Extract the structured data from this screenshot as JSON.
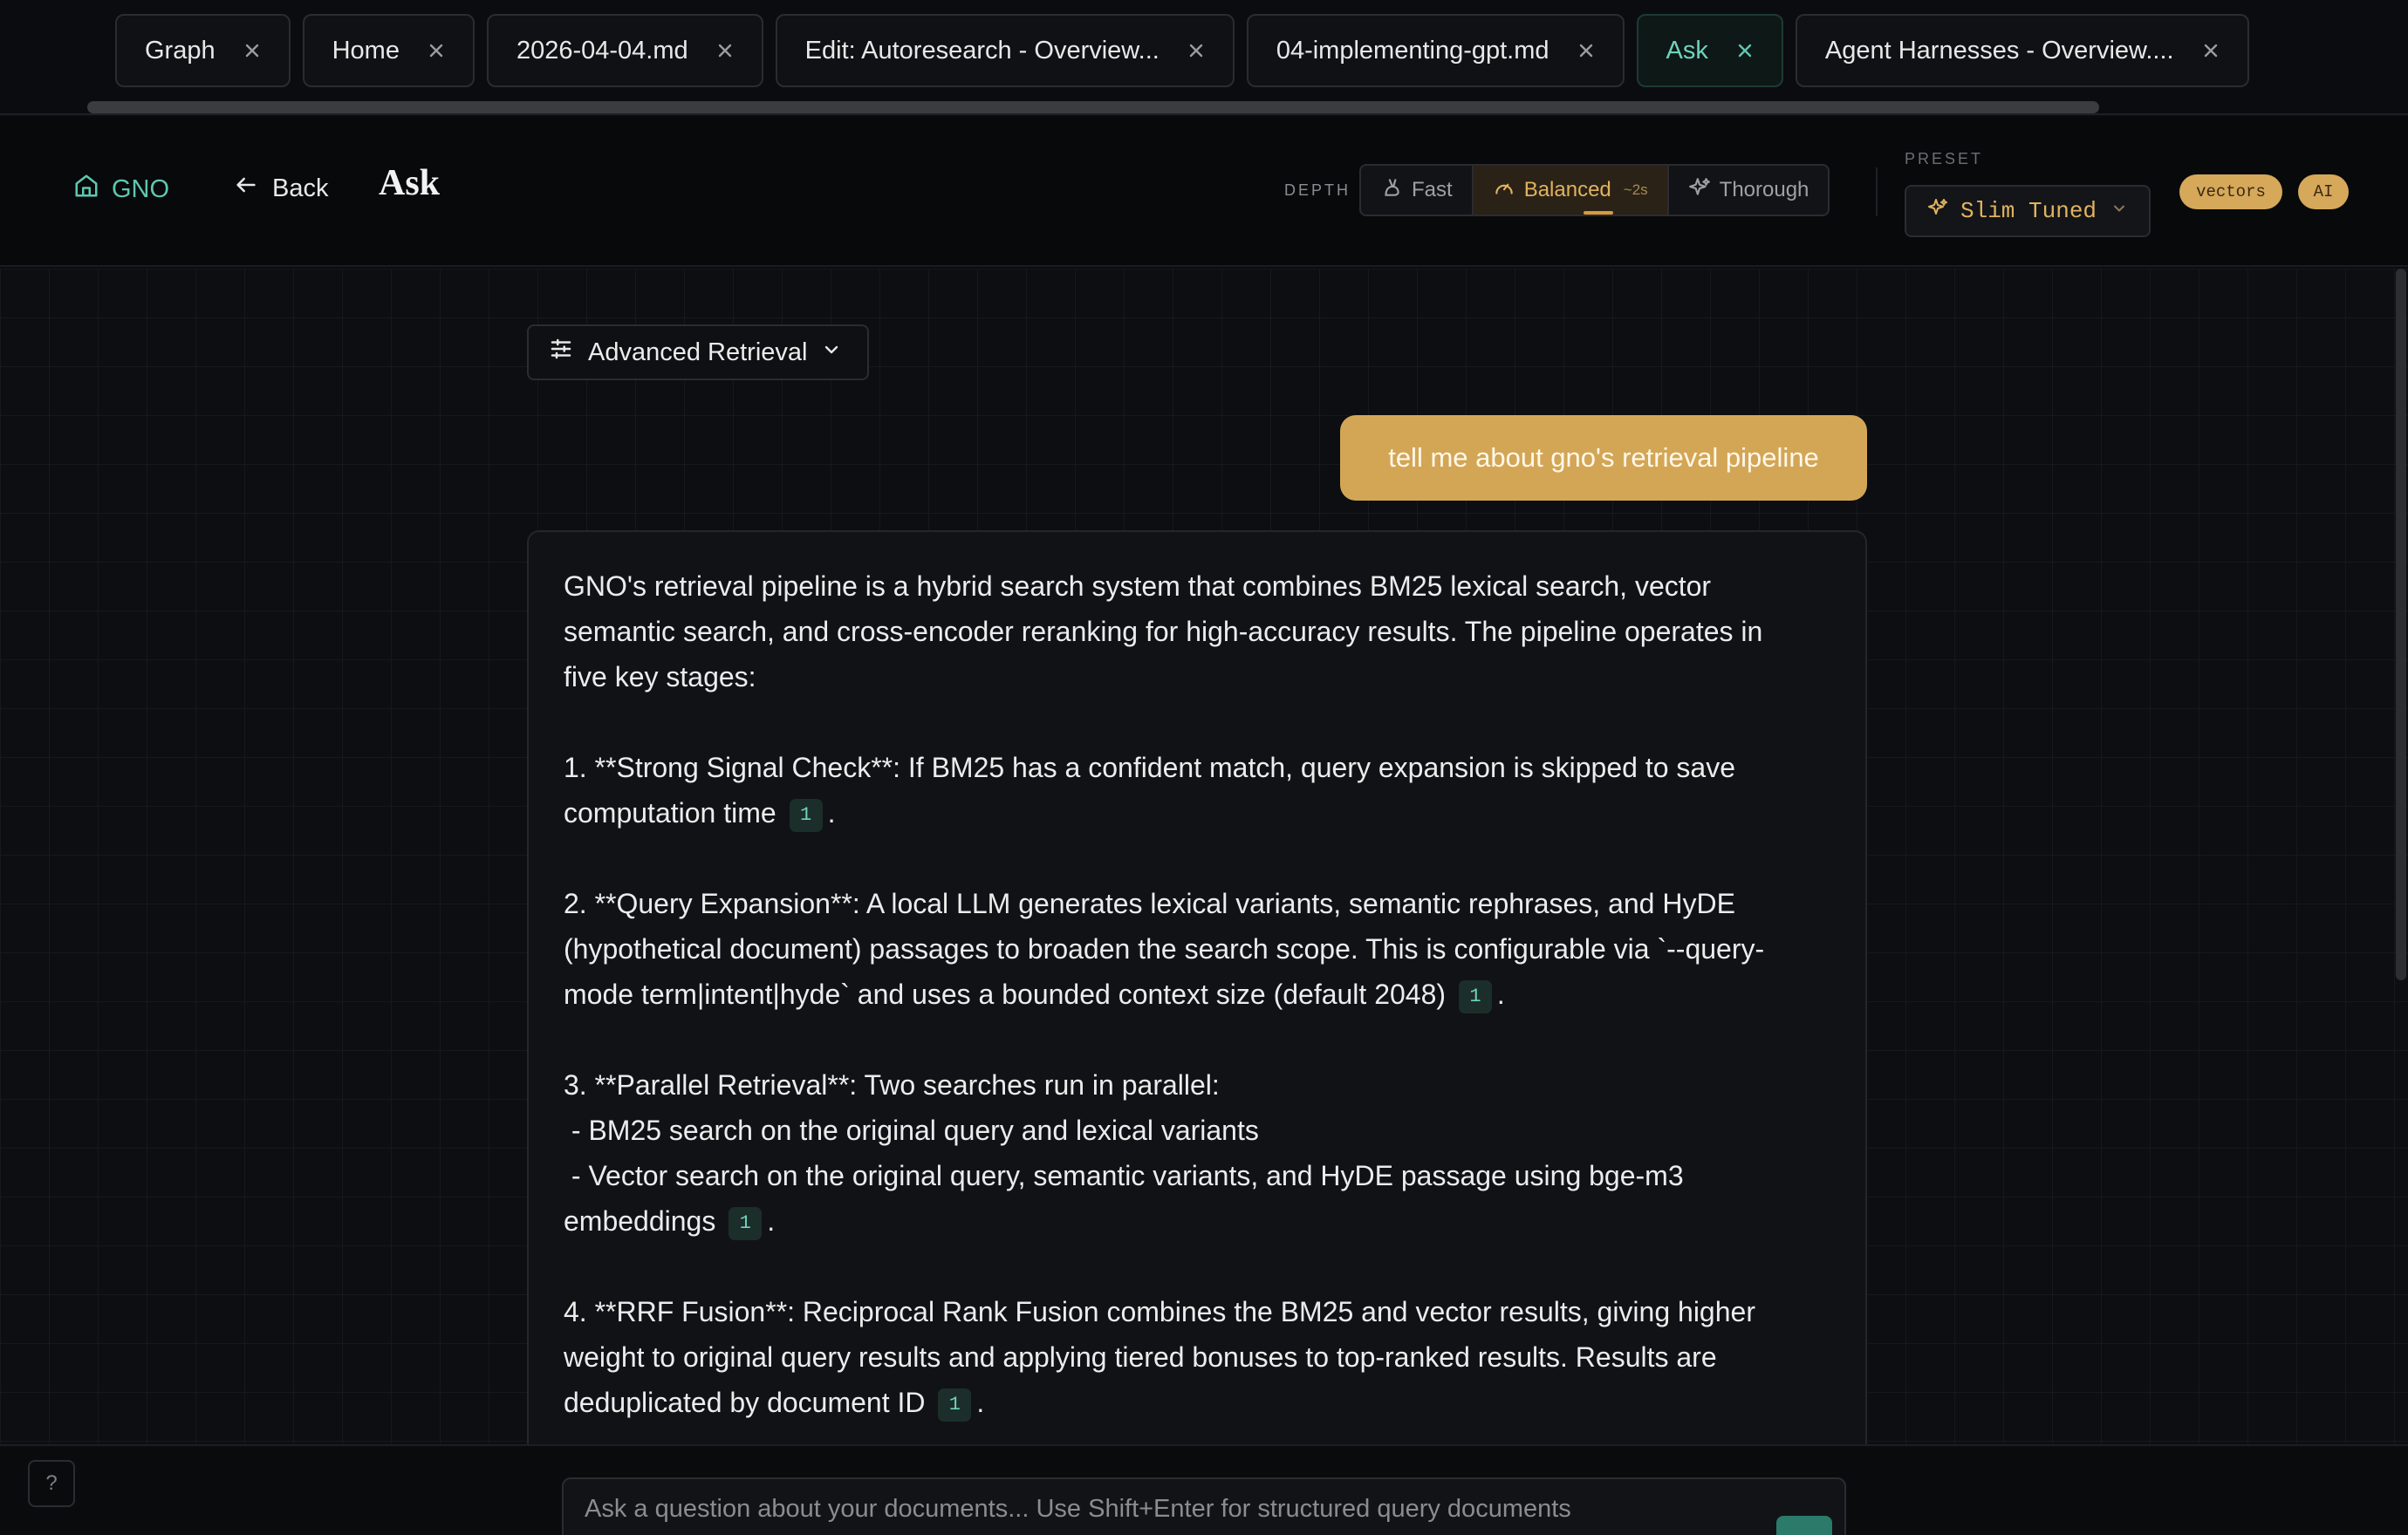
{
  "tabs": [
    {
      "label": "Graph",
      "active": false
    },
    {
      "label": "Home",
      "active": false
    },
    {
      "label": "2026-04-04.md",
      "active": false
    },
    {
      "label": "Edit: Autoresearch - Overview...",
      "active": false
    },
    {
      "label": "04-implementing-gpt.md",
      "active": false
    },
    {
      "label": "Ask",
      "active": true
    },
    {
      "label": "Agent Harnesses - Overview....",
      "active": false
    }
  ],
  "header": {
    "home_label": "GNO",
    "back_label": "Back",
    "title": "Ask",
    "depth_label": "DEPTH",
    "depth_options": [
      {
        "label": "Fast",
        "icon": "rabbit-icon"
      },
      {
        "label": "Balanced",
        "eta": "~2s",
        "icon": "gauge-icon",
        "selected": true
      },
      {
        "label": "Thorough",
        "icon": "sparkles-icon"
      }
    ],
    "preset_label": "PRESET",
    "preset_value": "Slim Tuned",
    "badges": {
      "vectors": "vectors",
      "ai": "AI"
    }
  },
  "retrieval": {
    "label": "Advanced Retrieval"
  },
  "conversation": {
    "question": "tell me about gno's retrieval pipeline",
    "answer": {
      "intro": [
        "GNO's retrieval pipeline is a hybrid search system that combines BM25 lexical search, vector",
        "semantic search, and cross-encoder reranking for high-accuracy results. The pipeline operates in",
        "five key stages:"
      ],
      "s1": [
        "1. **Strong Signal Check**: If BM25 has a confident match, query expansion is skipped to save",
        "computation time"
      ],
      "s2": [
        "2. **Query Expansion**: A local LLM generates lexical variants, semantic rephrases, and HyDE",
        "(hypothetical document) passages to broaden the search scope. This is configurable via `--query-",
        "mode term|intent|hyde` and uses a bounded context size (default 2048)"
      ],
      "s3": [
        "3. **Parallel Retrieval**: Two searches run in parallel:",
        " - BM25 search on the original query and lexical variants",
        " - Vector search on the original query, semantic variants, and HyDE passage using bge-m3",
        "embeddings"
      ],
      "s4": [
        "4. **RRF Fusion**: Reciprocal Rank Fusion combines the BM25 and vector results, giving higher",
        "weight to original query results and applying tiered bonuses to top-ranked results. Results are",
        "deduplicated by document ID"
      ],
      "citation": "1",
      "period": "."
    }
  },
  "composer": {
    "placeholder": "Ask a question about your documents... Use Shift+Enter for structured query documents",
    "help_label": "?"
  },
  "colors": {
    "accent_teal": "#5fc7b0",
    "accent_gold": "#d3a656",
    "background": "#0b0c0f"
  }
}
